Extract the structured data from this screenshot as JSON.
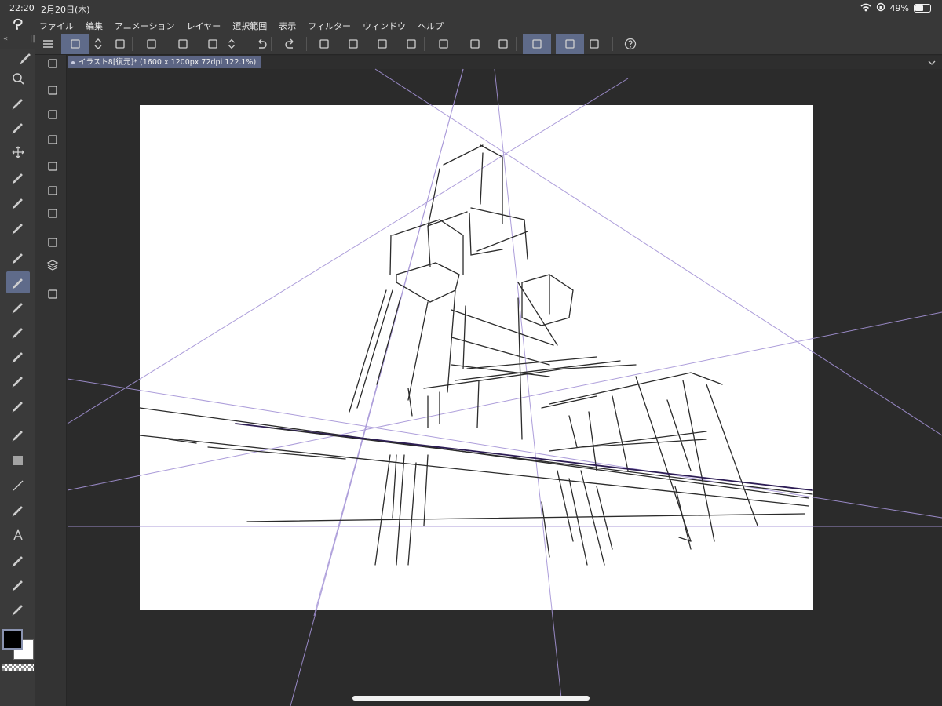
{
  "status": {
    "time": "22:20",
    "date": "2月20日(木)",
    "battery": "49%",
    "battery_level": 0.49
  },
  "menu": [
    "ファイル",
    "編集",
    "アニメーション",
    "レイヤー",
    "選択範囲",
    "表示",
    "フィルター",
    "ウィンドウ",
    "ヘルプ"
  ],
  "document": {
    "tab_title": "イラスト8[復元]* (1600 x 1200px 72dpi 122.1%)"
  },
  "colors": {
    "accent": "#5f6b8a",
    "panel": "#383838",
    "guide": "#a493d6",
    "main_color": "#000000",
    "sub_color": "#ffffff"
  },
  "commandbar": {
    "icons": [
      "menu-icon",
      "canvas-new-icon",
      "stepper-icon",
      "layer-reference-icon",
      "new-file-icon",
      "open-file-icon",
      "save-icon",
      "stepper-icon",
      "undo-icon",
      "redo-icon",
      "loading-spinner-icon",
      "transform-icon",
      "fill-icon",
      "crop-icon",
      "clear-selection-icon",
      "invert-selection-icon",
      "selection-border-icon",
      "ruler-snap-icon",
      "ruler-special-icon",
      "ruler-grid-icon",
      "help-icon"
    ]
  },
  "tools": [
    "pen-tool-icon",
    "zoom-icon",
    "hand-icon",
    "operation-icon",
    "move-icon",
    "lasso-icon",
    "magic-wand-icon",
    "eyedropper-icon",
    "pen-icon",
    "pencil-icon",
    "brush-icon",
    "airbrush-icon",
    "eraser-icon",
    "decoration-icon",
    "blend-icon",
    "fill-bucket-icon",
    "gradient-icon",
    "line-figure-icon",
    "ruler-icon",
    "text-icon",
    "balloon-icon",
    "correct-line-icon",
    "frame-icon"
  ],
  "subtools": [
    "navigator-icon",
    "tool-property-icon",
    "tool-settings-icon",
    "brush-size-icon",
    "color-wheel-icon",
    "color-set-icon",
    "animation-timeline-icon",
    "layer-property-icon",
    "layer-icon",
    "material-icon"
  ]
}
